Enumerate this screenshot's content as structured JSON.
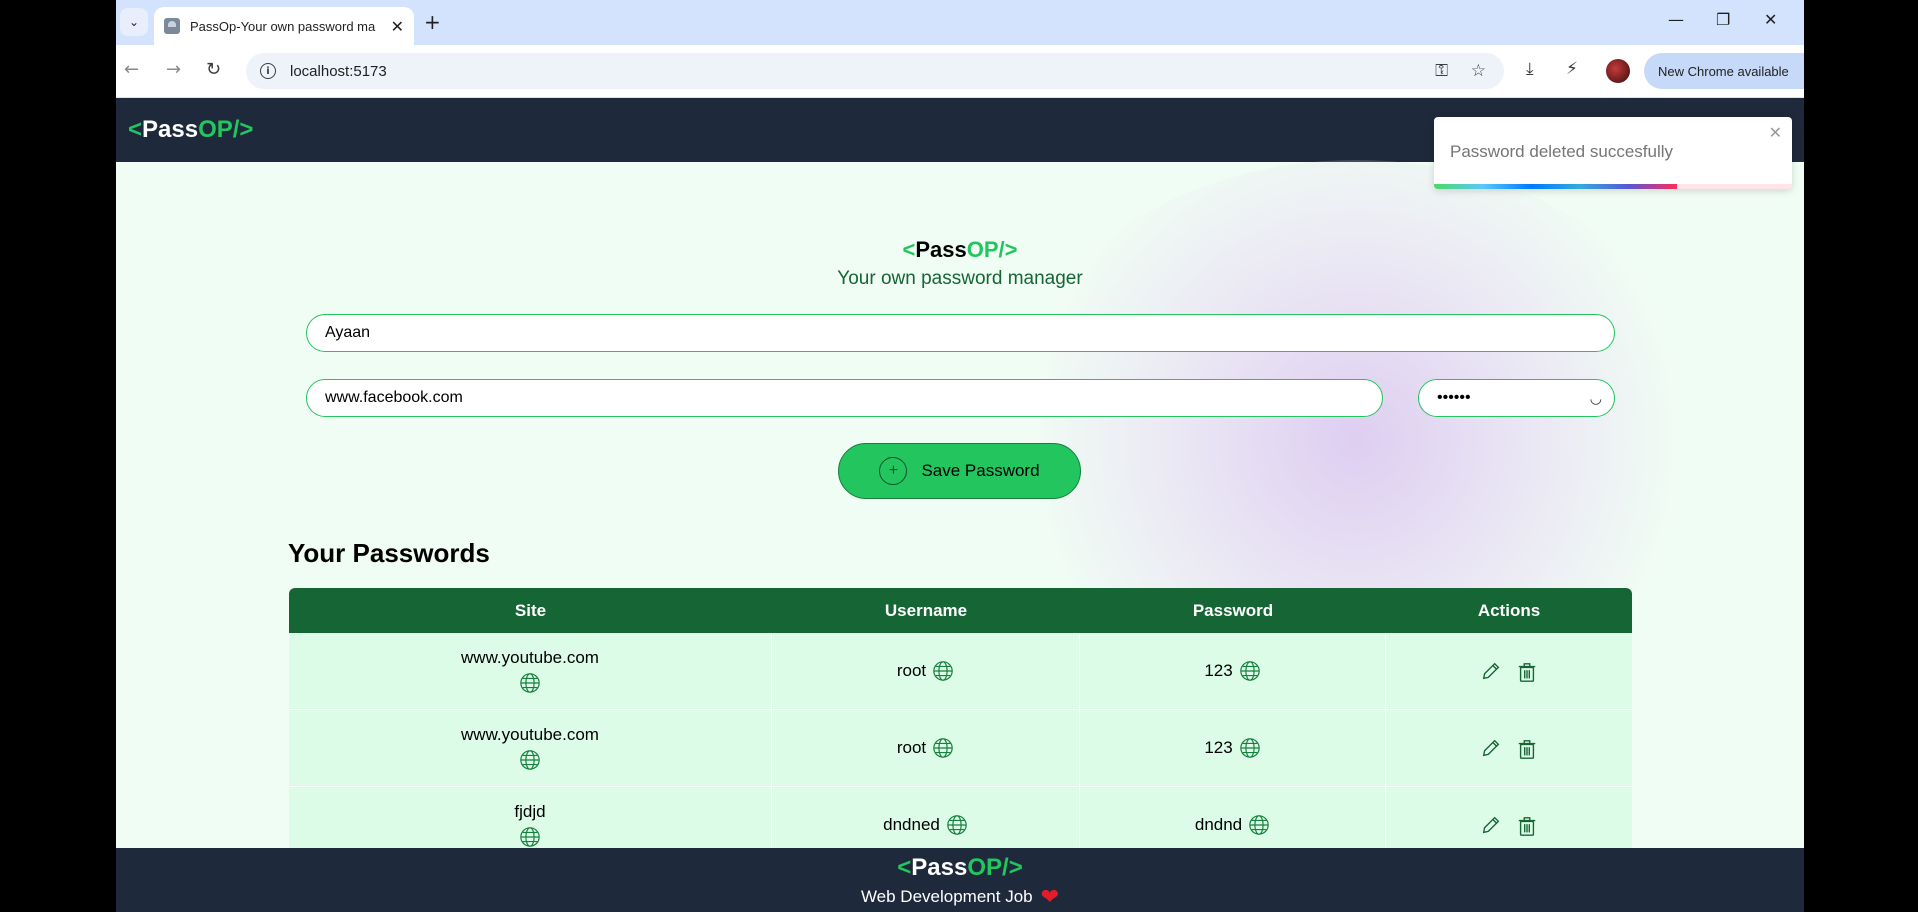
{
  "browser": {
    "tab_title": "PassOp-Your own password ma",
    "url": "localhost:5173",
    "update_label": "New Chrome available"
  },
  "brand": {
    "open": "<",
    "pass": "Pass",
    "op": "OP/>"
  },
  "toast": {
    "message": "Password deleted succesfully",
    "progress": 0.68
  },
  "form": {
    "subtitle": "Your own password manager",
    "username_value": "Ayaan",
    "site_value": "www.facebook.com",
    "password_value": "••••••",
    "save_label": "Save Password"
  },
  "passwords": {
    "title": "Your Passwords",
    "columns": [
      "Site",
      "Username",
      "Password",
      "Actions"
    ],
    "rows": [
      {
        "site": "www.youtube.com",
        "username": "root",
        "password": "123"
      },
      {
        "site": "www.youtube.com",
        "username": "root",
        "password": "123"
      },
      {
        "site": "fjdjd",
        "username": "dndned",
        "password": "dndnd"
      }
    ]
  },
  "footer": {
    "tagline": "Web Development Job"
  },
  "colors": {
    "brand_green": "#22c55e",
    "navbar": "#1e293b",
    "table_header": "#166534",
    "table_row": "#dcfce7"
  }
}
